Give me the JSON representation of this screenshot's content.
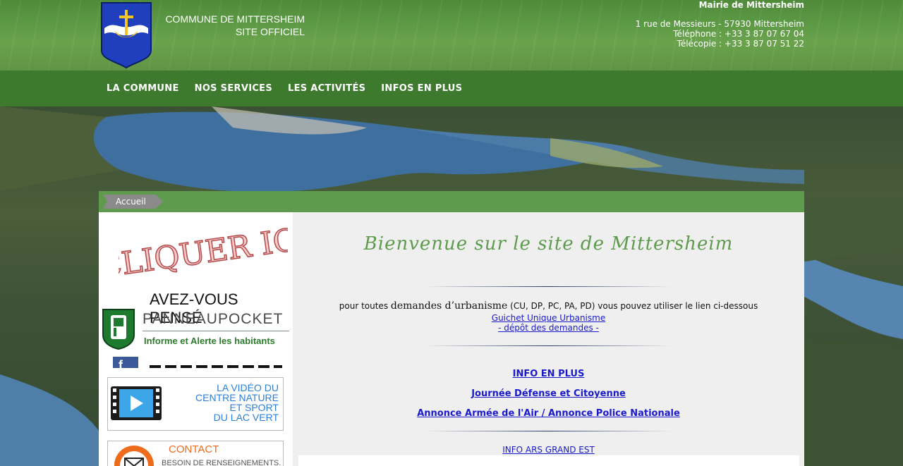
{
  "header": {
    "site_line1": "COMMUNE DE MITTERSHEIM",
    "site_line2": "SITE OFFICIEL",
    "mairie_title": "Mairie de Mittersheim",
    "address": "1 rue de Messieurs - 57930 Mittersheim",
    "phone": "Téléphone : +33 3 87 07 67 04",
    "fax": "Télécopie : +33 3 87 07 51 22"
  },
  "nav": {
    "items": [
      "LA COMMUNE",
      "NOS SERVICES",
      "LES ACTIVITÉS",
      "INFOS EN PLUS"
    ]
  },
  "breadcrumb": {
    "home": "Accueil"
  },
  "sidebar": {
    "cliquer_ici": "CLIQUER ICI",
    "panneaupocket": {
      "title": "AVEZ-VOUS PENSÉ",
      "name": "PANNEAUPOCKET",
      "tagline": "Informe et Alerte les habitants"
    },
    "video": {
      "line1": "LA VIDÉO DU",
      "line2": "CENTRE NATURE",
      "line3": "ET SPORT",
      "line4": "DU LAC VERT"
    },
    "contact": {
      "title": "CONTACT",
      "subtitle": "BESOIN DE RENSEIGNEMENTS."
    }
  },
  "main": {
    "welcome": "Bienvenue sur le site de Mittersheim",
    "urba_prefix": "pour toutes",
    "urba_serif": "demandes d’urbanisme",
    "urba_suffix": "(CU, DP, PC, PA, PD) vous pouvez utiliser le lien ci-dessous",
    "guichet_link": "Guichet Unique Urbanisme",
    "depot_link": "- dépôt des demandes -",
    "info_en_plus": "INFO EN PLUS",
    "jdc_link": "Journée Défense et Citoyenne",
    "annonce_link": "Annonce Armée de l'Air / Annonce Police Nationale",
    "ars_link": "INFO ARS GRAND EST"
  },
  "colors": {
    "nav_green": "#3d7a2d",
    "breadcrumb_green": "#5e9b4c",
    "link_blue": "#1a1acc",
    "welcome_green": "#5e9b4c",
    "contact_orange": "#ee6b1b",
    "video_blue": "#2c7fd6"
  }
}
